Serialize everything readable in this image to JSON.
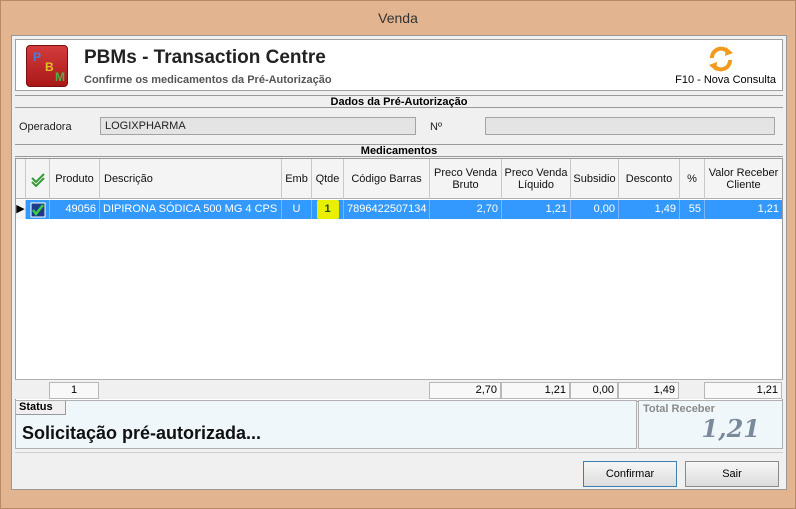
{
  "window": {
    "title": "Venda"
  },
  "header": {
    "logo": {
      "p": "P",
      "b": "B",
      "m": "M"
    },
    "title": "PBMs - Transaction Centre",
    "subtitle": "Confirme os medicamentos da Pré-Autorização",
    "refresh_icon": "refresh-arrows-icon",
    "refresh_label": "F10 - Nova Consulta"
  },
  "dados": {
    "section_title": "Dados da Pré-Autorização",
    "operadora_label": "Operadora",
    "operadora_value": "LOGIXPHARMA",
    "numero_label": "Nº",
    "numero_value": ""
  },
  "medicamentos": {
    "section_title": "Medicamentos",
    "columns": [
      "Produto",
      "Descrição",
      "Emb",
      "Qtde",
      "Código Barras",
      "Preco Venda Bruto",
      "Preco Venda Líquido",
      "Subsidio",
      "Desconto",
      "%",
      "Valor Receber Cliente"
    ],
    "rows": [
      {
        "indicator": "▶",
        "checked": true,
        "produto": "49056",
        "descricao": "DIPIRONA SÓDICA 500 MG 4 CPS",
        "emb": "U",
        "qtde": "1",
        "codigo_barras": "7896422507134",
        "preco_bruto": "2,70",
        "preco_liquido": "1,21",
        "subsidio": "0,00",
        "desconto": "1,49",
        "percent": "55",
        "valor_receber": "1,21"
      }
    ],
    "totals": {
      "count": "1",
      "preco_bruto": "2,70",
      "preco_liquido": "1,21",
      "subsidio": "0,00",
      "desconto": "1,49",
      "valor_receber": "1,21"
    }
  },
  "status": {
    "tab_label": "Status",
    "message": "Solicitação pré-autorizada..."
  },
  "total": {
    "label": "Total Receber",
    "value": "1,21"
  },
  "buttons": {
    "confirmar": "Confirmar",
    "sair": "Sair"
  },
  "colors": {
    "window_frame": "#e2b48f",
    "selection": "#3399ff",
    "qtde_highlight": "#ffff00"
  }
}
